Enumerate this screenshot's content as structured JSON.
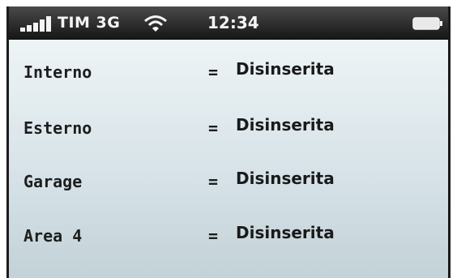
{
  "status_bar": {
    "carrier": "TIM 3G",
    "time": "12:34",
    "icons": [
      "signal-bars-icon",
      "wifi-icon",
      "battery-icon"
    ]
  },
  "zones": [
    {
      "name": "Interno",
      "separator": "=",
      "state": "Disinserita"
    },
    {
      "name": "Esterno",
      "separator": "=",
      "state": "Disinserita"
    },
    {
      "name": "Garage",
      "separator": "=",
      "state": "Disinserita"
    },
    {
      "name": "Area 4",
      "separator": "=",
      "state": "Disinserita"
    }
  ],
  "colors": {
    "status_bar": "#1b1b1b",
    "screen_top": "#eef4f6",
    "screen_bottom": "#c3d2d8",
    "text": "#1e1e1e"
  }
}
